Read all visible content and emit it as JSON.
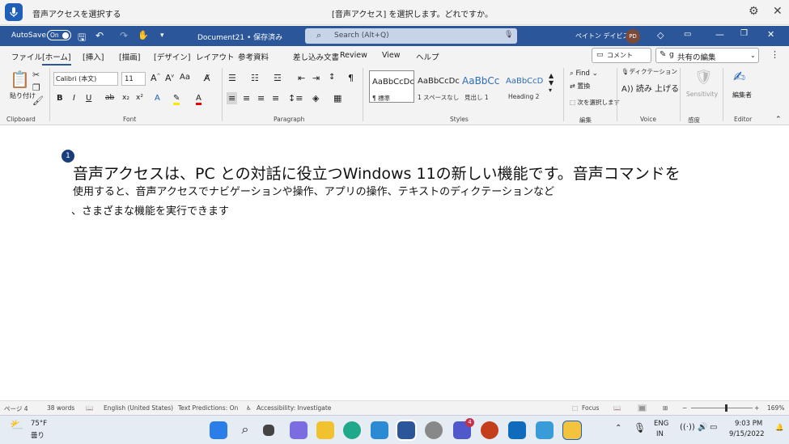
{
  "voice": {
    "title": "音声アクセスを選択する",
    "status": "[音声アクセス] を選択します。どれですか。"
  },
  "titlebar": {
    "autosave": "AutoSave",
    "toggle": "On",
    "doc": "Document21 • 保存済み",
    "search": "Search (Alt+Q)",
    "user": "ペイトン デイビス",
    "initials": "PD"
  },
  "menu": {
    "items": [
      "ファイル",
      "[ホーム]",
      "[挿入]",
      "[描画]",
      "[デザイン]",
      "レイアウト",
      "参考資料",
      "差し込み文書",
      "Review",
      "View",
      "ヘルプ"
    ],
    "comment": "コメント",
    "share": "共有の編集",
    "share_prefix": "g"
  },
  "ribbon": {
    "paste": "貼り付け",
    "font": "Calibri (本文)",
    "size": "11",
    "groups": {
      "clipboard": "Clipboard",
      "font": "Font",
      "paragraph": "Paragraph",
      "styles": "Styles",
      "editing": "編集",
      "voice": "Voice",
      "sensitivity_group": "感度",
      "editor": "Editor"
    },
    "styles": [
      {
        "preview": "AaBbCcDc",
        "name": "¶ 標準"
      },
      {
        "preview": "AaBbCcDc",
        "name": "1 スペースなし"
      },
      {
        "preview": "AaBbCc",
        "name": "見出し 1"
      },
      {
        "preview": "AaBbCcD",
        "name": "Heading 2"
      }
    ],
    "find": "Find",
    "replace": "置換",
    "select": "次を選択します",
    "dictate": "ディクテーション",
    "readaloud": "読み 上げる",
    "sensitivity": "Sensitivity",
    "editor": "編集者"
  },
  "document": {
    "badge": "1",
    "line1": "音声アクセスは、PC との対話に役立つWindows 11の新しい機能です。音声コマンドを",
    "line2": "使用すると、音声アクセスでナビゲーションや操作、アプリの操作、テキストのディクテーションなど",
    "line3": "、さまざまな機能を実行できます"
  },
  "status": {
    "page": "ページ 4",
    "words": "38 words",
    "lang": "English (United States)",
    "predictions": "Text Predictions: On",
    "accessibility": "Accessibility: Investigate",
    "focus": "Focus",
    "zoom": "169%"
  },
  "taskbar": {
    "temp": "75°F",
    "weather": "曇り",
    "lang1": "ENG",
    "lang2": "IN",
    "time": "9:03 PM",
    "date": "9/15/2022",
    "teams_badge": "4"
  },
  "colors": {
    "word_blue": "#2b579a",
    "accent": "#1f5fb8"
  }
}
